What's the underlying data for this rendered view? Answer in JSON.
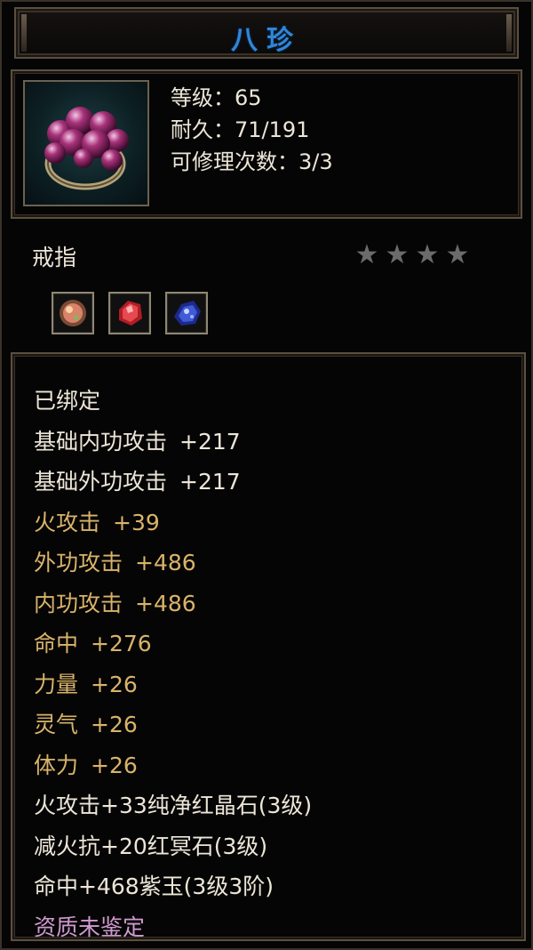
{
  "title": "八珍",
  "item": {
    "icon": "ring-icon",
    "stats": [
      "等级：65",
      "耐久：71/191",
      "可修理次数：3/3"
    ],
    "type": "戒指",
    "stars": [
      "★",
      "★",
      "★",
      "★"
    ],
    "gems": [
      "orange-gem-icon",
      "red-gem-icon",
      "blue-gem-icon"
    ]
  },
  "properties": [
    {
      "label": "已绑定",
      "value": "",
      "color": "#ece6d8"
    },
    {
      "label": "基础内功攻击",
      "value": "+217",
      "color": "#ece6d8"
    },
    {
      "label": "基础外功攻击",
      "value": "+217",
      "color": "#ece6d8"
    },
    {
      "label": "火攻击",
      "value": "+39",
      "color": "#d8b36a"
    },
    {
      "label": "外功攻击",
      "value": "+486",
      "color": "#d8b36a"
    },
    {
      "label": "内功攻击",
      "value": "+486",
      "color": "#d8b36a"
    },
    {
      "label": "命中",
      "value": "+276",
      "color": "#d8b36a"
    },
    {
      "label": "力量",
      "value": "+26",
      "color": "#d8b36a"
    },
    {
      "label": "灵气",
      "value": "+26",
      "color": "#d8b36a"
    },
    {
      "label": "体力",
      "value": "+26",
      "color": "#d8b36a"
    },
    {
      "label": "火攻击+33纯净红晶石(3级)",
      "value": "",
      "color": "#ece6d8"
    },
    {
      "label": "减火抗+20红冥石(3级)",
      "value": "",
      "color": "#ece6d8"
    },
    {
      "label": "命中+468紫玉(3级3阶)",
      "value": "",
      "color": "#ece6d8"
    },
    {
      "label": "资质未鉴定",
      "value": "",
      "color": "#d09ad0"
    }
  ],
  "colors": {
    "title": "#2f86d8",
    "white": "#ece6d8",
    "gold": "#d8b36a",
    "pink": "#d09ad0",
    "star": "#6b6b6b"
  }
}
